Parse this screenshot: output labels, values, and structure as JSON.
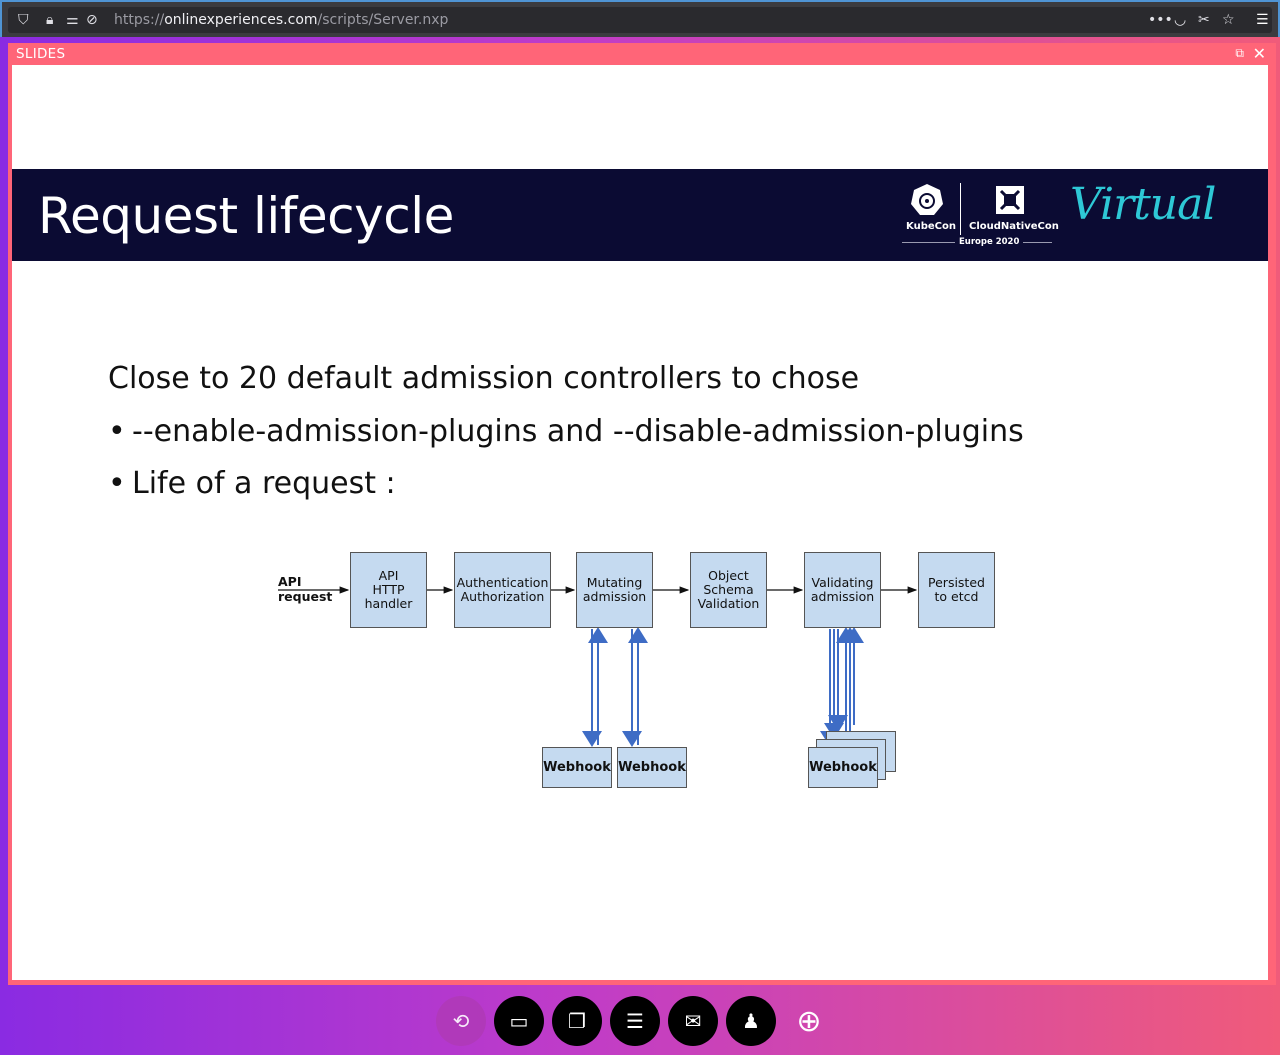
{
  "browser": {
    "url_scheme": "https://",
    "url_host": "onlinexperiences.com",
    "url_path": "/scripts/Server.nxp"
  },
  "panel": {
    "title": "SLIDES"
  },
  "slide": {
    "title": "Request lifecycle",
    "logos": {
      "kubecon": "KubeCon",
      "cloudnativecon": "CloudNativeCon",
      "event": "Europe 2020",
      "virtual": "Virtual"
    },
    "lines": [
      "Close to 20 default admission controllers to chose",
      "--enable-admission-plugins and --disable-admission-plugins",
      "Life of a request :"
    ],
    "bullet": "•",
    "diagram": {
      "input_label": "API request",
      "stages": [
        "API\nHTTP\nhandler",
        "Authentication\nAuthorization",
        "Mutating\nadmission",
        "Object\nSchema\nValidation",
        "Validating\nadmission",
        "Persisted\nto etcd"
      ],
      "webhooks": [
        "Webhook",
        "Webhook",
        "Webhook"
      ]
    }
  },
  "toolbar": {
    "buttons": [
      "refresh-icon",
      "video-icon",
      "slides-icon",
      "agenda-icon",
      "chat-icon",
      "profile-icon",
      "globe-icon"
    ]
  }
}
